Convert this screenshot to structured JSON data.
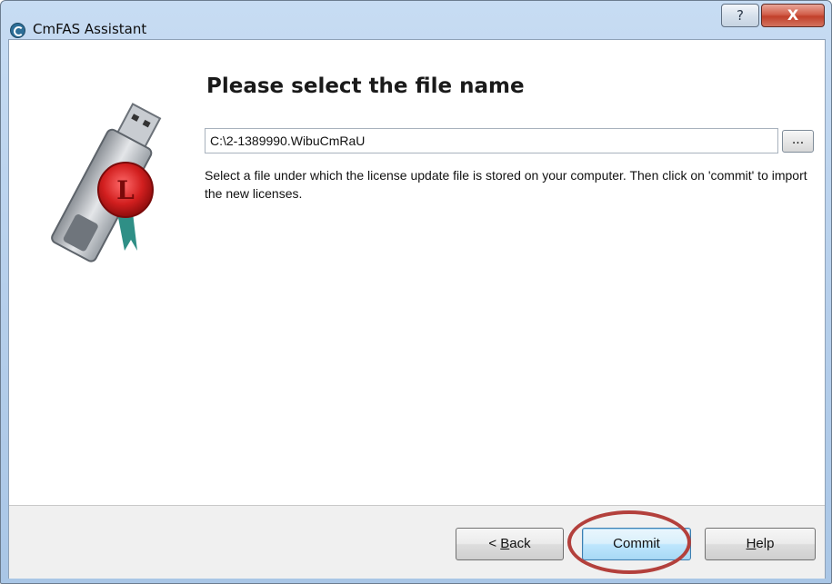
{
  "window": {
    "title": "CmFAS Assistant",
    "help_glyph": "?",
    "close_glyph": "X"
  },
  "page": {
    "heading": "Please select the file name",
    "file_path_value": "C:\\2-1389990.WibuCmRaU",
    "browse_label": "...",
    "description": "Select a file under which the license update file is stored on your computer. Then click on 'commit' to import the new licenses."
  },
  "footer": {
    "back_prefix": "< ",
    "back_mnemonic": "B",
    "back_rest": "ack",
    "commit_label": "Commit",
    "help_mnemonic": "H",
    "help_rest": "elp"
  },
  "icons": {
    "app": "cmfas-app-icon",
    "logo": "usb-license-seal-icon"
  },
  "colors": {
    "titlebar": "#b6cfeb",
    "close_button": "#c1402b",
    "highlight_ring": "#b3403c",
    "seal_red": "#d21f1f"
  }
}
